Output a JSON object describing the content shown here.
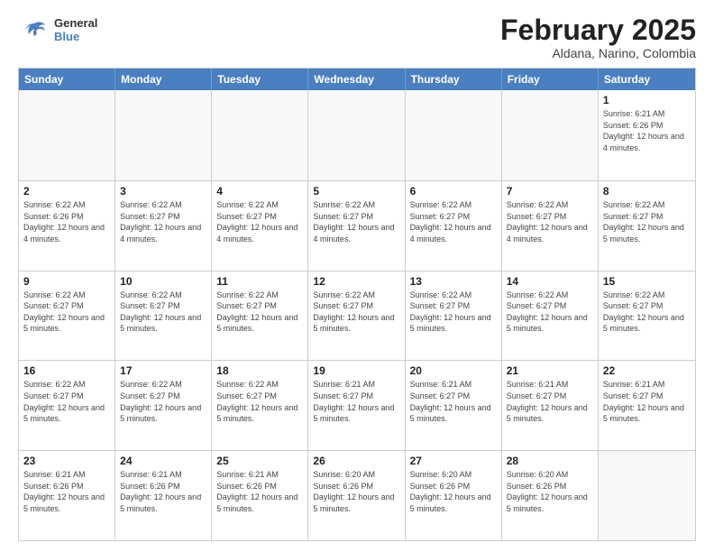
{
  "logo": {
    "general": "General",
    "blue": "Blue"
  },
  "title": "February 2025",
  "subtitle": "Aldana, Narino, Colombia",
  "headers": [
    "Sunday",
    "Monday",
    "Tuesday",
    "Wednesday",
    "Thursday",
    "Friday",
    "Saturday"
  ],
  "weeks": [
    [
      {
        "day": "",
        "info": ""
      },
      {
        "day": "",
        "info": ""
      },
      {
        "day": "",
        "info": ""
      },
      {
        "day": "",
        "info": ""
      },
      {
        "day": "",
        "info": ""
      },
      {
        "day": "",
        "info": ""
      },
      {
        "day": "1",
        "info": "Sunrise: 6:21 AM\nSunset: 6:26 PM\nDaylight: 12 hours and 4 minutes."
      }
    ],
    [
      {
        "day": "2",
        "info": "Sunrise: 6:22 AM\nSunset: 6:26 PM\nDaylight: 12 hours and 4 minutes."
      },
      {
        "day": "3",
        "info": "Sunrise: 6:22 AM\nSunset: 6:27 PM\nDaylight: 12 hours and 4 minutes."
      },
      {
        "day": "4",
        "info": "Sunrise: 6:22 AM\nSunset: 6:27 PM\nDaylight: 12 hours and 4 minutes."
      },
      {
        "day": "5",
        "info": "Sunrise: 6:22 AM\nSunset: 6:27 PM\nDaylight: 12 hours and 4 minutes."
      },
      {
        "day": "6",
        "info": "Sunrise: 6:22 AM\nSunset: 6:27 PM\nDaylight: 12 hours and 4 minutes."
      },
      {
        "day": "7",
        "info": "Sunrise: 6:22 AM\nSunset: 6:27 PM\nDaylight: 12 hours and 4 minutes."
      },
      {
        "day": "8",
        "info": "Sunrise: 6:22 AM\nSunset: 6:27 PM\nDaylight: 12 hours and 5 minutes."
      }
    ],
    [
      {
        "day": "9",
        "info": "Sunrise: 6:22 AM\nSunset: 6:27 PM\nDaylight: 12 hours and 5 minutes."
      },
      {
        "day": "10",
        "info": "Sunrise: 6:22 AM\nSunset: 6:27 PM\nDaylight: 12 hours and 5 minutes."
      },
      {
        "day": "11",
        "info": "Sunrise: 6:22 AM\nSunset: 6:27 PM\nDaylight: 12 hours and 5 minutes."
      },
      {
        "day": "12",
        "info": "Sunrise: 6:22 AM\nSunset: 6:27 PM\nDaylight: 12 hours and 5 minutes."
      },
      {
        "day": "13",
        "info": "Sunrise: 6:22 AM\nSunset: 6:27 PM\nDaylight: 12 hours and 5 minutes."
      },
      {
        "day": "14",
        "info": "Sunrise: 6:22 AM\nSunset: 6:27 PM\nDaylight: 12 hours and 5 minutes."
      },
      {
        "day": "15",
        "info": "Sunrise: 6:22 AM\nSunset: 6:27 PM\nDaylight: 12 hours and 5 minutes."
      }
    ],
    [
      {
        "day": "16",
        "info": "Sunrise: 6:22 AM\nSunset: 6:27 PM\nDaylight: 12 hours and 5 minutes."
      },
      {
        "day": "17",
        "info": "Sunrise: 6:22 AM\nSunset: 6:27 PM\nDaylight: 12 hours and 5 minutes."
      },
      {
        "day": "18",
        "info": "Sunrise: 6:22 AM\nSunset: 6:27 PM\nDaylight: 12 hours and 5 minutes."
      },
      {
        "day": "19",
        "info": "Sunrise: 6:21 AM\nSunset: 6:27 PM\nDaylight: 12 hours and 5 minutes."
      },
      {
        "day": "20",
        "info": "Sunrise: 6:21 AM\nSunset: 6:27 PM\nDaylight: 12 hours and 5 minutes."
      },
      {
        "day": "21",
        "info": "Sunrise: 6:21 AM\nSunset: 6:27 PM\nDaylight: 12 hours and 5 minutes."
      },
      {
        "day": "22",
        "info": "Sunrise: 6:21 AM\nSunset: 6:27 PM\nDaylight: 12 hours and 5 minutes."
      }
    ],
    [
      {
        "day": "23",
        "info": "Sunrise: 6:21 AM\nSunset: 6:26 PM\nDaylight: 12 hours and 5 minutes."
      },
      {
        "day": "24",
        "info": "Sunrise: 6:21 AM\nSunset: 6:26 PM\nDaylight: 12 hours and 5 minutes."
      },
      {
        "day": "25",
        "info": "Sunrise: 6:21 AM\nSunset: 6:26 PM\nDaylight: 12 hours and 5 minutes."
      },
      {
        "day": "26",
        "info": "Sunrise: 6:20 AM\nSunset: 6:26 PM\nDaylight: 12 hours and 5 minutes."
      },
      {
        "day": "27",
        "info": "Sunrise: 6:20 AM\nSunset: 6:26 PM\nDaylight: 12 hours and 5 minutes."
      },
      {
        "day": "28",
        "info": "Sunrise: 6:20 AM\nSunset: 6:26 PM\nDaylight: 12 hours and 5 minutes."
      },
      {
        "day": "",
        "info": ""
      }
    ]
  ]
}
